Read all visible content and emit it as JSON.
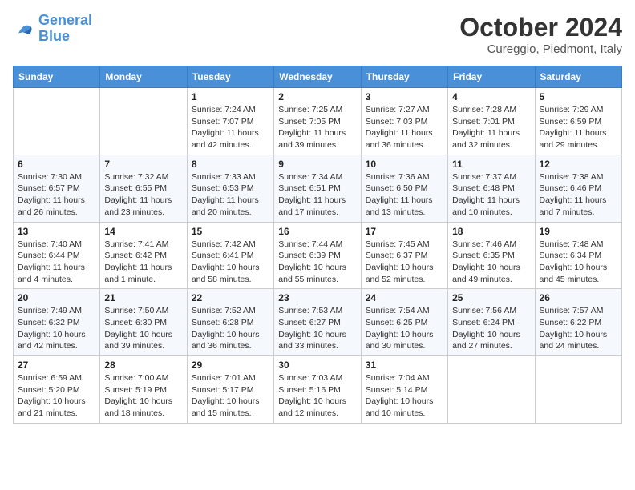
{
  "header": {
    "logo_line1": "General",
    "logo_line2": "Blue",
    "month_year": "October 2024",
    "location": "Cureggio, Piedmont, Italy"
  },
  "days_of_week": [
    "Sunday",
    "Monday",
    "Tuesday",
    "Wednesday",
    "Thursday",
    "Friday",
    "Saturday"
  ],
  "weeks": [
    [
      {
        "day": "",
        "info": ""
      },
      {
        "day": "",
        "info": ""
      },
      {
        "day": "1",
        "info": "Sunrise: 7:24 AM\nSunset: 7:07 PM\nDaylight: 11 hours and 42 minutes."
      },
      {
        "day": "2",
        "info": "Sunrise: 7:25 AM\nSunset: 7:05 PM\nDaylight: 11 hours and 39 minutes."
      },
      {
        "day": "3",
        "info": "Sunrise: 7:27 AM\nSunset: 7:03 PM\nDaylight: 11 hours and 36 minutes."
      },
      {
        "day": "4",
        "info": "Sunrise: 7:28 AM\nSunset: 7:01 PM\nDaylight: 11 hours and 32 minutes."
      },
      {
        "day": "5",
        "info": "Sunrise: 7:29 AM\nSunset: 6:59 PM\nDaylight: 11 hours and 29 minutes."
      }
    ],
    [
      {
        "day": "6",
        "info": "Sunrise: 7:30 AM\nSunset: 6:57 PM\nDaylight: 11 hours and 26 minutes."
      },
      {
        "day": "7",
        "info": "Sunrise: 7:32 AM\nSunset: 6:55 PM\nDaylight: 11 hours and 23 minutes."
      },
      {
        "day": "8",
        "info": "Sunrise: 7:33 AM\nSunset: 6:53 PM\nDaylight: 11 hours and 20 minutes."
      },
      {
        "day": "9",
        "info": "Sunrise: 7:34 AM\nSunset: 6:51 PM\nDaylight: 11 hours and 17 minutes."
      },
      {
        "day": "10",
        "info": "Sunrise: 7:36 AM\nSunset: 6:50 PM\nDaylight: 11 hours and 13 minutes."
      },
      {
        "day": "11",
        "info": "Sunrise: 7:37 AM\nSunset: 6:48 PM\nDaylight: 11 hours and 10 minutes."
      },
      {
        "day": "12",
        "info": "Sunrise: 7:38 AM\nSunset: 6:46 PM\nDaylight: 11 hours and 7 minutes."
      }
    ],
    [
      {
        "day": "13",
        "info": "Sunrise: 7:40 AM\nSunset: 6:44 PM\nDaylight: 11 hours and 4 minutes."
      },
      {
        "day": "14",
        "info": "Sunrise: 7:41 AM\nSunset: 6:42 PM\nDaylight: 11 hours and 1 minute."
      },
      {
        "day": "15",
        "info": "Sunrise: 7:42 AM\nSunset: 6:41 PM\nDaylight: 10 hours and 58 minutes."
      },
      {
        "day": "16",
        "info": "Sunrise: 7:44 AM\nSunset: 6:39 PM\nDaylight: 10 hours and 55 minutes."
      },
      {
        "day": "17",
        "info": "Sunrise: 7:45 AM\nSunset: 6:37 PM\nDaylight: 10 hours and 52 minutes."
      },
      {
        "day": "18",
        "info": "Sunrise: 7:46 AM\nSunset: 6:35 PM\nDaylight: 10 hours and 49 minutes."
      },
      {
        "day": "19",
        "info": "Sunrise: 7:48 AM\nSunset: 6:34 PM\nDaylight: 10 hours and 45 minutes."
      }
    ],
    [
      {
        "day": "20",
        "info": "Sunrise: 7:49 AM\nSunset: 6:32 PM\nDaylight: 10 hours and 42 minutes."
      },
      {
        "day": "21",
        "info": "Sunrise: 7:50 AM\nSunset: 6:30 PM\nDaylight: 10 hours and 39 minutes."
      },
      {
        "day": "22",
        "info": "Sunrise: 7:52 AM\nSunset: 6:28 PM\nDaylight: 10 hours and 36 minutes."
      },
      {
        "day": "23",
        "info": "Sunrise: 7:53 AM\nSunset: 6:27 PM\nDaylight: 10 hours and 33 minutes."
      },
      {
        "day": "24",
        "info": "Sunrise: 7:54 AM\nSunset: 6:25 PM\nDaylight: 10 hours and 30 minutes."
      },
      {
        "day": "25",
        "info": "Sunrise: 7:56 AM\nSunset: 6:24 PM\nDaylight: 10 hours and 27 minutes."
      },
      {
        "day": "26",
        "info": "Sunrise: 7:57 AM\nSunset: 6:22 PM\nDaylight: 10 hours and 24 minutes."
      }
    ],
    [
      {
        "day": "27",
        "info": "Sunrise: 6:59 AM\nSunset: 5:20 PM\nDaylight: 10 hours and 21 minutes."
      },
      {
        "day": "28",
        "info": "Sunrise: 7:00 AM\nSunset: 5:19 PM\nDaylight: 10 hours and 18 minutes."
      },
      {
        "day": "29",
        "info": "Sunrise: 7:01 AM\nSunset: 5:17 PM\nDaylight: 10 hours and 15 minutes."
      },
      {
        "day": "30",
        "info": "Sunrise: 7:03 AM\nSunset: 5:16 PM\nDaylight: 10 hours and 12 minutes."
      },
      {
        "day": "31",
        "info": "Sunrise: 7:04 AM\nSunset: 5:14 PM\nDaylight: 10 hours and 10 minutes."
      },
      {
        "day": "",
        "info": ""
      },
      {
        "day": "",
        "info": ""
      }
    ]
  ]
}
